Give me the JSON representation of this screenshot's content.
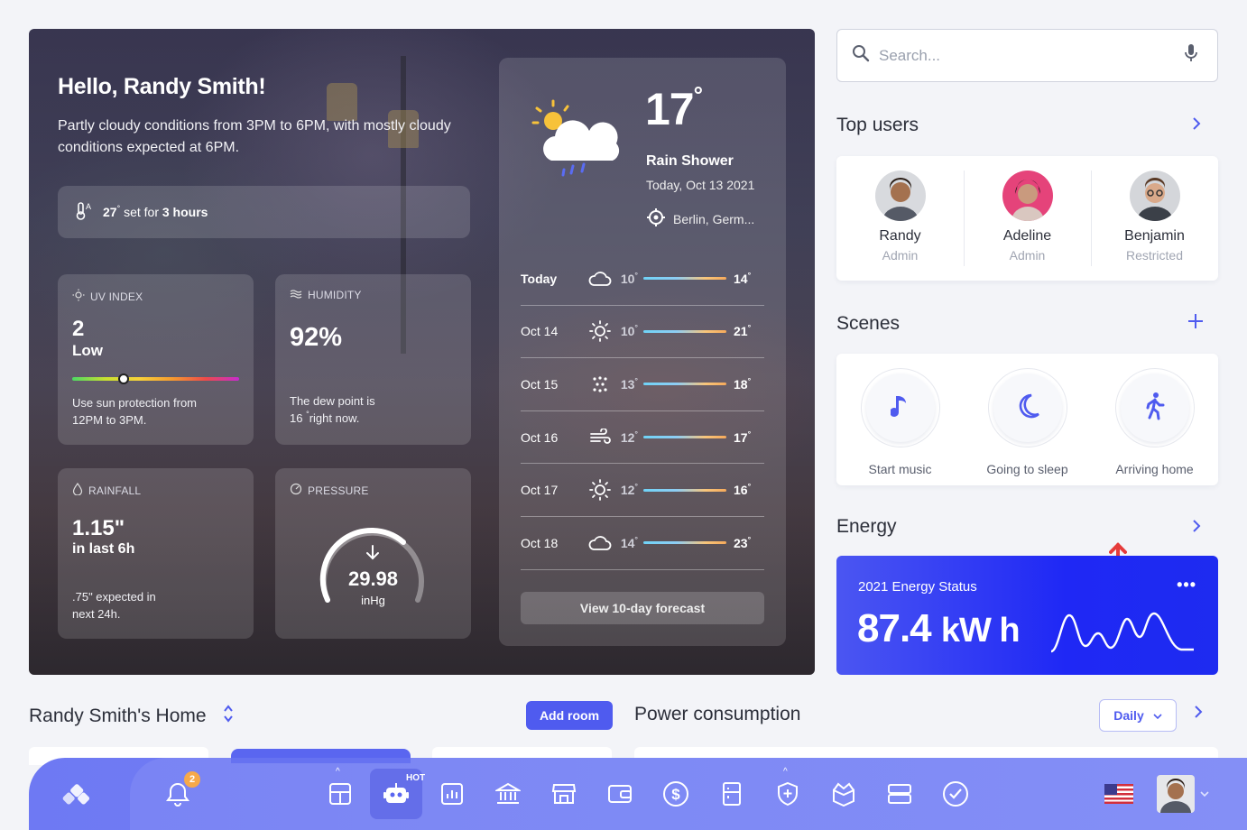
{
  "hero": {
    "greeting": "Hello, Randy Smith!",
    "summary": "Partly cloudy conditions from 3PM to 6PM, with mostly cloudy conditions expected at 6PM.",
    "alarm": {
      "temp": "27",
      "text": "set for",
      "duration": "3 hours"
    },
    "uv": {
      "title": "UV INDEX",
      "value": "2",
      "level": "Low",
      "note": "Use sun protection from 12PM to 3PM.",
      "scale_fraction": 0.31
    },
    "humidity": {
      "title": "HUMIDITY",
      "value": "92%",
      "note_a": "The dew point is",
      "note_b": "16",
      "note_c": "right now."
    },
    "rainfall": {
      "title": "RAINFALL",
      "value": "1.15\"",
      "sub": "in last 6h",
      "note": ".75\" expected in next 24h."
    },
    "pressure": {
      "title": "PRESSURE",
      "value": "29.98",
      "unit": "inHg"
    }
  },
  "forecast": {
    "temp": "17",
    "condition": "Rain Shower",
    "date": "Today, Oct 13 2021",
    "location": "Berlin, Germ...",
    "days": [
      {
        "day": "Today",
        "icon": "cloud-icon",
        "lo": "10",
        "hi": "14"
      },
      {
        "day": "Oct 14",
        "icon": "sun-icon",
        "lo": "10",
        "hi": "21"
      },
      {
        "day": "Oct 15",
        "icon": "snow-icon",
        "lo": "13",
        "hi": "18"
      },
      {
        "day": "Oct 16",
        "icon": "wind-icon",
        "lo": "12",
        "hi": "17"
      },
      {
        "day": "Oct 17",
        "icon": "sun-icon",
        "lo": "12",
        "hi": "16"
      },
      {
        "day": "Oct 18",
        "icon": "cloud-icon",
        "lo": "14",
        "hi": "23"
      }
    ],
    "button": "View 10-day forecast"
  },
  "search": {
    "placeholder": "Search..."
  },
  "top_users": {
    "title": "Top users",
    "users": [
      {
        "name": "Randy",
        "role": "Admin"
      },
      {
        "name": "Adeline",
        "role": "Admin"
      },
      {
        "name": "Benjamin",
        "role": "Restricted"
      }
    ]
  },
  "scenes": {
    "title": "Scenes",
    "items": [
      {
        "label": "Start music",
        "icon": "music-note-icon"
      },
      {
        "label": "Going to sleep",
        "icon": "moon-icon"
      },
      {
        "label": "Arriving home",
        "icon": "walking-icon"
      }
    ]
  },
  "energy": {
    "title": "Energy",
    "status": "2021 Energy Status",
    "value": "87.4",
    "unit": "kW h",
    "accent": "#2430f4"
  },
  "home": {
    "title": "Randy Smith's Home",
    "add_room": "Add room"
  },
  "power": {
    "title": "Power consumption",
    "period": "Daily"
  },
  "dock": {
    "notification_count": "2",
    "hot_label": "HOT"
  },
  "colors": {
    "primary": "#4f5bef",
    "dock": "#7480f5",
    "badge": "#f6a94a"
  }
}
